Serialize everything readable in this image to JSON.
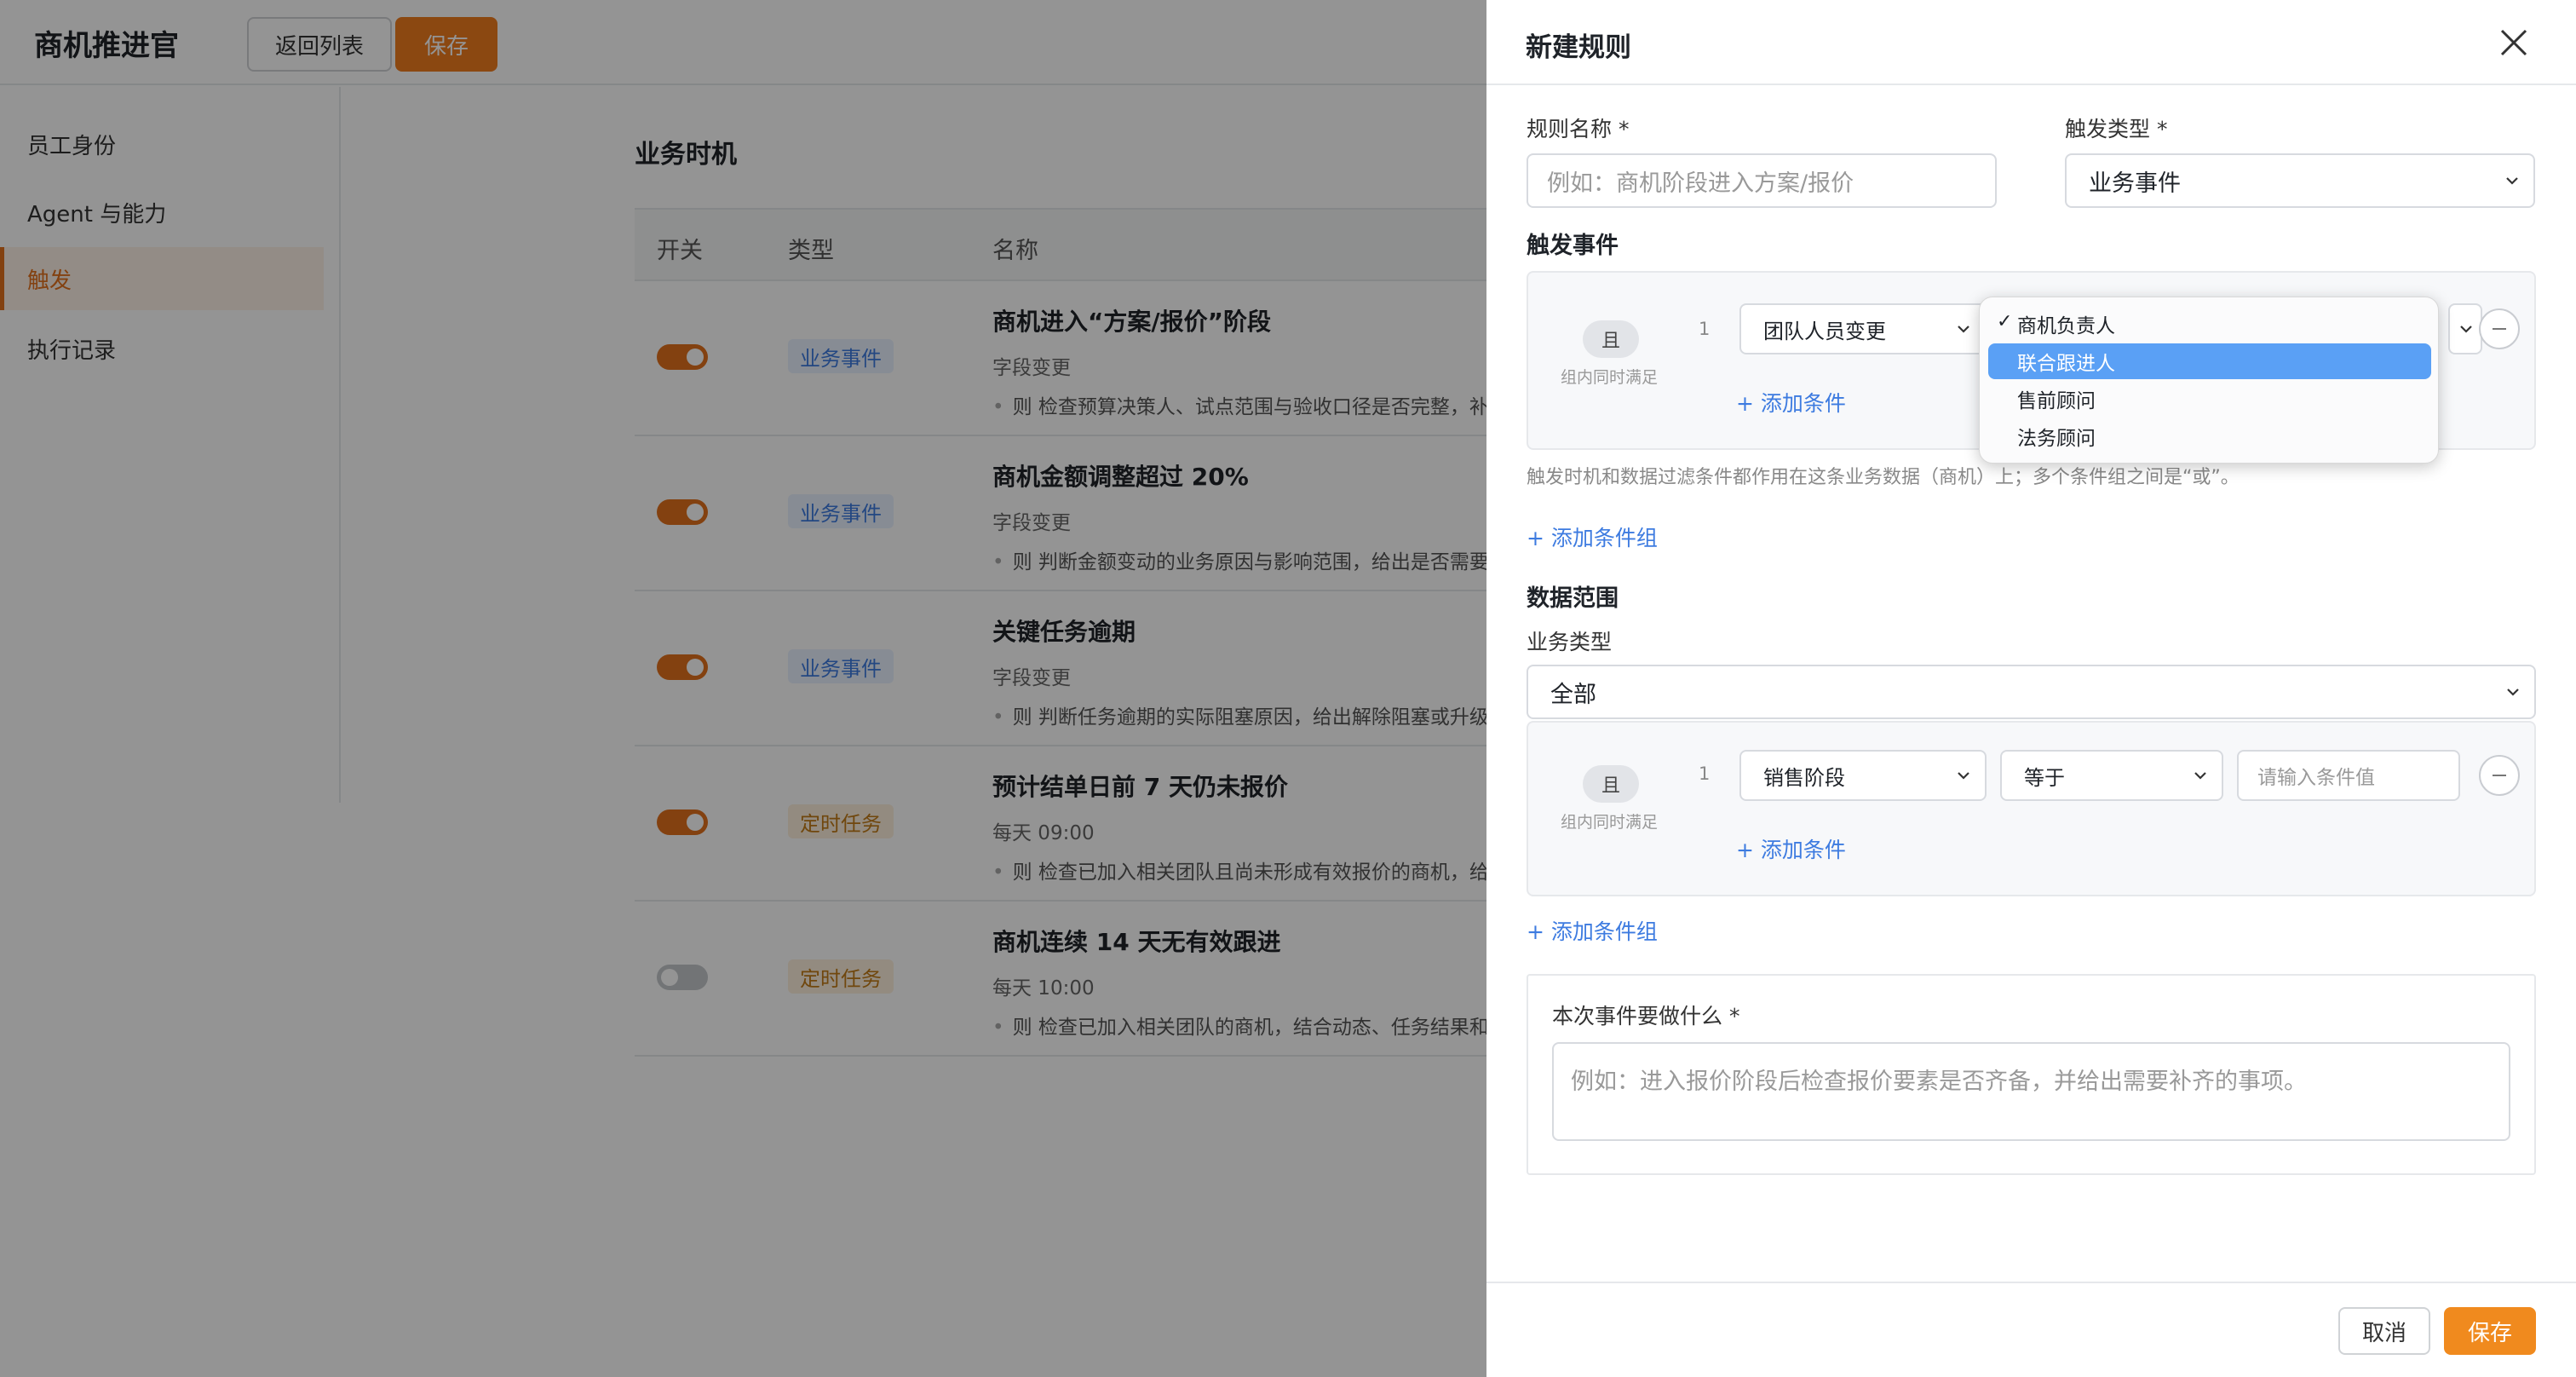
{
  "app": {
    "title": "商机推进官",
    "back_label": "返回列表",
    "save_label": "保存"
  },
  "sidebar": {
    "items": [
      {
        "label": "员工身份"
      },
      {
        "label": "Agent 与能力"
      },
      {
        "label": "触发"
      },
      {
        "label": "执行记录"
      }
    ],
    "active": "触发"
  },
  "main": {
    "title": "业务时机",
    "columns": [
      "开关",
      "类型",
      "名称"
    ],
    "rows": [
      {
        "enabled": true,
        "type": "业务事件",
        "name": "商机进入“方案/报价”阶段",
        "trigger": "字段变更",
        "desc": "则 检查预算决策人、试点范围与验收口径是否完整，补"
      },
      {
        "enabled": true,
        "type": "业务事件",
        "name": "商机金额调整超过 20%",
        "trigger": "字段变更",
        "desc": "则 判断金额变动的业务原因与影响范围，给出是否需要"
      },
      {
        "enabled": true,
        "type": "业务事件",
        "name": "关键任务逾期",
        "trigger": "字段变更",
        "desc": "则 判断任务逾期的实际阻塞原因，给出解除阻塞或升级"
      },
      {
        "enabled": true,
        "type": "定时任务",
        "name": "预计结单日前 7 天仍未报价",
        "trigger": "每天 09:00",
        "desc": "则 检查已加入相关团队且尚未形成有效报价的商机，给"
      },
      {
        "enabled": false,
        "type": "定时任务",
        "name": "商机连续 14 天无有效跟进",
        "trigger": "每天 10:00",
        "desc": "则 检查已加入相关团队的商机，结合动态、任务结果和"
      }
    ]
  },
  "drawer": {
    "title": "新建规则",
    "rule_name_label": "规则名称 *",
    "rule_name_placeholder": "例如：商机阶段进入方案/报价",
    "trigger_type_label": "触发类型 *",
    "trigger_type_value": "业务事件",
    "trigger_event_section": "触发事件",
    "group1": {
      "and_label": "且",
      "hint": "组内同时满足",
      "index": "1",
      "field_value": "团队人员变更",
      "add_condition": "+ 添加条件"
    },
    "note": "触发时机和数据过滤条件都作用在这条业务数据（商机）上；多个条件组之间是“或”。",
    "add_group_1": "+ 添加条件组",
    "data_scope_section": "数据范围",
    "biz_type_label": "业务类型",
    "biz_type_value": "全部",
    "group2": {
      "and_label": "且",
      "hint": "组内同时满足",
      "index": "1",
      "field_value": "销售阶段",
      "operator_value": "等于",
      "value_placeholder": "请输入条件值",
      "add_condition": "+ 添加条件"
    },
    "add_group_2": "+ 添加条件组",
    "task_label": "本次事件要做什么 *",
    "task_placeholder": "例如：进入报价阶段后检查报价要素是否齐备，并给出需要补齐的事项。",
    "cancel_label": "取消",
    "save_label": "保存"
  },
  "dropdown": {
    "options": [
      "商机负责人",
      "联合跟进人",
      "售前顾问",
      "法务顾问"
    ],
    "selected": "商机负责人",
    "highlighted": "联合跟进人",
    "check_mark": "✓"
  },
  "colors": {
    "accent": "#e2711d",
    "link": "#3d7be0",
    "highlight": "#5aa0f5"
  }
}
